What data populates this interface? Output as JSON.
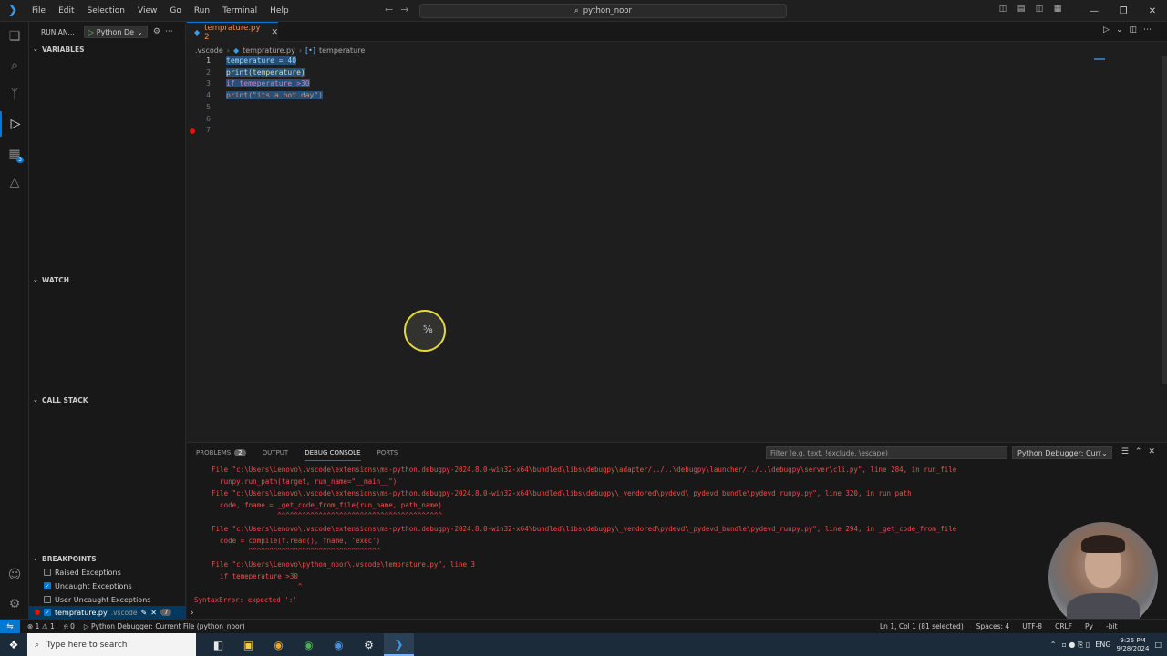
{
  "menu": [
    "File",
    "Edit",
    "Selection",
    "View",
    "Go",
    "Run",
    "Terminal",
    "Help"
  ],
  "command_center": "python_noor",
  "sidebar": {
    "title": "RUN AN...",
    "config": "Python De",
    "sections": {
      "variables": "VARIABLES",
      "watch": "WATCH",
      "call_stack": "CALL STACK",
      "breakpoints": "BREAKPOINTS"
    },
    "breakpoints": [
      {
        "label": "Raised Exceptions",
        "checked": false
      },
      {
        "label": "Uncaught Exceptions",
        "checked": true
      },
      {
        "label": "User Uncaught Exceptions",
        "checked": false
      }
    ],
    "bp_file": {
      "name": "temprature.py",
      "folder": ".vscode",
      "count": "7"
    }
  },
  "editor": {
    "tab_label": "temprature.py 2",
    "breadcrumb": [
      ".vscode",
      "temprature.py",
      "temperature"
    ],
    "lines": [
      {
        "n": "1",
        "text": "temperature = 40"
      },
      {
        "n": "2",
        "text": "print(temperature)"
      },
      {
        "n": "3",
        "text": "if temeperature >30"
      },
      {
        "n": "4",
        "text": "print(\"its a hot day\")"
      },
      {
        "n": "5",
        "text": ""
      },
      {
        "n": "6",
        "text": ""
      },
      {
        "n": "7",
        "text": ""
      }
    ]
  },
  "panel": {
    "tabs": {
      "problems": "PROBLEMS",
      "problems_count": "2",
      "output": "OUTPUT",
      "debug_console": "DEBUG CONSOLE",
      "ports": "PORTS"
    },
    "filter_placeholder": "Filter (e.g. text, !exclude, \\escape)",
    "debugger_select": "Python Debugger: Curr",
    "console_lines": [
      "  File \"c:\\Users\\Lenovo\\.vscode\\extensions\\ms-python.debugpy-2024.8.0-win32-x64\\bundled\\libs\\debugpy\\adapter/../..\\debugpy\\launcher/../..\\debugpy\\server\\cli.py\", line 284, in run_file",
      "    runpy.run_path(target, run_name=\"__main__\")",
      "  File \"c:\\Users\\Lenovo\\.vscode\\extensions\\ms-python.debugpy-2024.8.0-win32-x64\\bundled\\libs\\debugpy\\_vendored\\pydevd\\_pydevd_bundle\\pydevd_runpy.py\", line 320, in run_path",
      "    code, fname = _get_code_from_file(run_name, path_name)",
      "                  ^^^^^^^^^^^^^^^^^^^^^^^^^^^^^^^^^^^^^^^^",
      "  File \"c:\\Users\\Lenovo\\.vscode\\extensions\\ms-python.debugpy-2024.8.0-win32-x64\\bundled\\libs\\debugpy\\_vendored\\pydevd\\_pydevd_bundle\\pydevd_runpy.py\", line 294, in _get_code_from_file",
      "    code = compile(f.read(), fname, 'exec')",
      "           ^^^^^^^^^^^^^^^^^^^^^^^^^^^^^^^^",
      "  File \"c:\\Users\\Lenovo\\python_noor\\.vscode\\temprature.py\", line 3",
      "    if temeperature >30",
      "                       ^",
      "SyntaxError: expected ':'"
    ]
  },
  "statusbar": {
    "errors": "1",
    "warnings": "1",
    "ports": "0",
    "debug": "Python Debugger: Current File (python_noor)",
    "position": "Ln 1, Col 1 (81 selected)",
    "spaces": "Spaces: 4",
    "encoding": "UTF-8",
    "eol": "CRLF",
    "lang": "Py",
    "bits": "-bit"
  },
  "taskbar": {
    "search_placeholder": "Type here to search",
    "lang": "ENG",
    "time": "9:26 PM",
    "date": "9/28/2024"
  },
  "colors": {
    "accent": "#0078d4",
    "error": "#f14c4c",
    "selection": "#264f78"
  }
}
